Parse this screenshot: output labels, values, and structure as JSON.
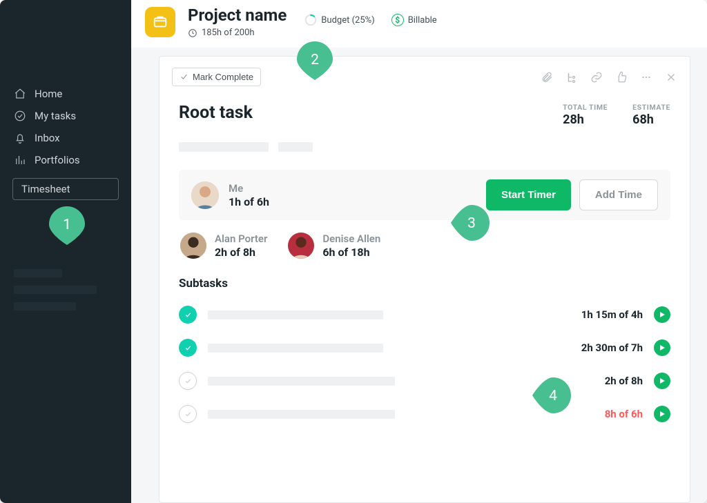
{
  "sidebar": {
    "items": [
      {
        "label": "Home"
      },
      {
        "label": "My tasks"
      },
      {
        "label": "Inbox"
      },
      {
        "label": "Portfolios"
      }
    ],
    "timesheet_label": "Timesheet"
  },
  "header": {
    "title": "Project name",
    "hours": "185h of 200h",
    "budget_label": "Budget (25%)",
    "billable_label": "Billable"
  },
  "panel": {
    "mark_complete": "Mark Complete",
    "task_title": "Root task",
    "total_time_lbl": "TOTAL TIME",
    "total_time_val": "28h",
    "estimate_lbl": "ESTIMATE",
    "estimate_val": "68h",
    "start_timer": "Start Timer",
    "add_time": "Add Time",
    "me": {
      "name": "Me",
      "time": "1h of 6h"
    },
    "others": [
      {
        "name": "Alan Porter",
        "time": "2h of 8h"
      },
      {
        "name": "Denise Allen",
        "time": "6h of 18h"
      }
    ],
    "subtasks_h": "Subtasks",
    "subtasks": [
      {
        "done": true,
        "time": "1h 15m of 4h",
        "over": false
      },
      {
        "done": true,
        "time": "2h 30m of 7h",
        "over": false
      },
      {
        "done": false,
        "time": "2h of 8h",
        "over": false
      },
      {
        "done": false,
        "time": "8h of 6h",
        "over": true
      }
    ]
  },
  "pins": {
    "p1": "1",
    "p2": "2",
    "p3": "3",
    "p4": "4"
  }
}
